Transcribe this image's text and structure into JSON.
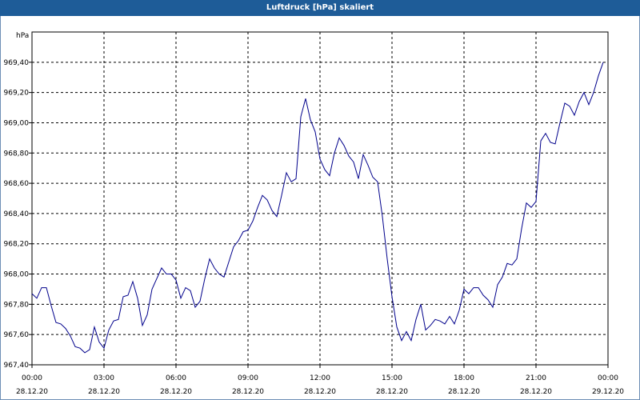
{
  "window": {
    "title": "Luftdruck [hPa] skaliert"
  },
  "chart_data": {
    "type": "line",
    "ylabel": "hPa",
    "ylim": [
      967.4,
      969.6
    ],
    "yticks": [
      "967,40",
      "967,60",
      "967,80",
      "968,00",
      "968,20",
      "968,40",
      "968,60",
      "968,80",
      "969,00",
      "969,20",
      "969,40"
    ],
    "xticks": [
      {
        "time": "00:00",
        "date": "28.12.20"
      },
      {
        "time": "03:00",
        "date": "28.12.20"
      },
      {
        "time": "06:00",
        "date": "28.12.20"
      },
      {
        "time": "09:00",
        "date": "28.12.20"
      },
      {
        "time": "12:00",
        "date": "28.12.20"
      },
      {
        "time": "15:00",
        "date": "28.12.20"
      },
      {
        "time": "18:00",
        "date": "28.12.20"
      },
      {
        "time": "21:00",
        "date": "28.12.20"
      },
      {
        "time": "00:00",
        "date": "29.12.20"
      }
    ],
    "grid": true,
    "line_color": "#00008b",
    "series": [
      {
        "x_hours": [
          0,
          0.2,
          0.4,
          0.6,
          0.8,
          1.0,
          1.2,
          1.4,
          1.6,
          1.8,
          2.0,
          2.2,
          2.4,
          2.6,
          2.8,
          3.0,
          3.2,
          3.4,
          3.6,
          3.8,
          4.0,
          4.2,
          4.4,
          4.6,
          4.8,
          5.0,
          5.2,
          5.4,
          5.6,
          5.8,
          6.0,
          6.2,
          6.4,
          6.6,
          6.8,
          7.0,
          7.2,
          7.4,
          7.6,
          7.8,
          8.0,
          8.2,
          8.4,
          8.6,
          8.8,
          9.0,
          9.2,
          9.4,
          9.6,
          9.8,
          10.0,
          10.2,
          10.4,
          10.6,
          10.8,
          11.0,
          11.2,
          11.4,
          11.6,
          11.8,
          12.0,
          12.2,
          12.4,
          12.6,
          12.8,
          13.0,
          13.2,
          13.4,
          13.6,
          13.8,
          14.0,
          14.2,
          14.4,
          14.6,
          14.8,
          15.0,
          15.2,
          15.4,
          15.6,
          15.8,
          16.0,
          16.2,
          16.4,
          16.6,
          16.8,
          17.0,
          17.2,
          17.4,
          17.6,
          17.8,
          18.0,
          18.2,
          18.4,
          18.6,
          18.8,
          19.0,
          19.2,
          19.4,
          19.6,
          19.8,
          20.0,
          20.2,
          20.4,
          20.6,
          20.8,
          21.0,
          21.2,
          21.4,
          21.6,
          21.8,
          22.0,
          22.2,
          22.4,
          22.6,
          22.8,
          23.0,
          23.2,
          23.4,
          23.6,
          23.8
        ],
        "values": [
          967.87,
          967.84,
          967.91,
          967.91,
          967.79,
          967.68,
          967.67,
          967.64,
          967.59,
          967.52,
          967.51,
          967.48,
          967.5,
          967.65,
          967.55,
          967.51,
          967.63,
          967.69,
          967.7,
          967.85,
          967.86,
          967.95,
          967.84,
          967.66,
          967.73,
          967.9,
          967.97,
          968.04,
          968.0,
          968.0,
          967.96,
          967.84,
          967.91,
          967.89,
          967.78,
          967.82,
          967.97,
          968.1,
          968.04,
          968.0,
          967.98,
          968.08,
          968.18,
          968.22,
          968.28,
          968.29,
          968.35,
          968.44,
          968.52,
          968.49,
          968.42,
          968.38,
          968.52,
          968.67,
          968.61,
          968.63,
          969.04,
          969.16,
          969.02,
          968.94,
          968.76,
          968.69,
          968.65,
          968.8,
          968.9,
          968.85,
          968.78,
          968.74,
          968.63,
          968.79,
          968.72,
          968.64,
          968.61,
          968.38,
          968.1,
          967.85,
          967.65,
          967.56,
          967.62,
          967.56,
          967.7,
          967.8,
          967.63,
          967.66,
          967.7,
          967.69,
          967.67,
          967.72,
          967.67,
          967.76,
          967.9,
          967.87,
          967.91,
          967.91,
          967.86,
          967.83,
          967.78,
          967.93,
          967.98,
          968.07,
          968.06,
          968.1,
          968.3,
          968.47,
          968.44,
          968.48,
          968.88,
          968.93,
          968.87,
          968.86,
          969.0,
          969.13,
          969.11,
          969.05,
          969.14,
          969.2,
          969.12,
          969.2,
          969.31,
          969.4,
          969.37
        ]
      }
    ]
  }
}
